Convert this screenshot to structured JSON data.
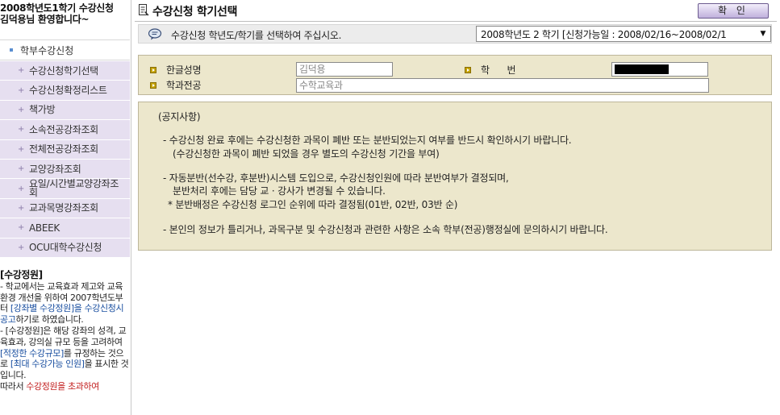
{
  "sidebar": {
    "welcome": "2008학년도1학기 수강신청\n김덕용님 환영합니다~",
    "menu_head": "학부수강신청",
    "items": [
      {
        "label": "수강신청학기선택"
      },
      {
        "label": "수강신청확정리스트"
      },
      {
        "label": "책가방"
      },
      {
        "label": "소속전공강좌조회"
      },
      {
        "label": "전체전공강좌조회"
      },
      {
        "label": "교양강좌조회"
      },
      {
        "label": "요일/시간별교양강좌조회"
      },
      {
        "label": "교과목명강좌조회"
      },
      {
        "label": "ABEEK"
      },
      {
        "label": "OCU대학수강신청"
      }
    ],
    "notice": {
      "title": "[수강정원]",
      "p1_a": "- 학교에서는 교육효과 제고와 교육환경 개선을 위하여 2007학년도부터 ",
      "p1_hl": "[강좌별 수강정원]을 수강신청시 공고",
      "p1_b": "하기로 하였습니다.",
      "p2_a": "- [수강정원]은 해당 강좌의 성격, 교육효과, 강의실 규모 등을 고려하여 ",
      "p2_hl1": "[적정한 수강규모]",
      "p2_b": "를 규정하는 것으로 ",
      "p2_hl2": "[최대 수강가능 인원]",
      "p2_c": "을 표시한 것입니다.",
      "p3_a": "따라서 ",
      "p3_red": "수강정원을 초과하여"
    }
  },
  "header": {
    "title": "수강신청 학기선택",
    "confirm_label": "확 인",
    "instruction": "수강신청 학년도/학기를 선택하여 주십시오.",
    "term_select": "2008학년도 2 학기 [신청가능일 : 2008/02/16~2008/02/1"
  },
  "student": {
    "name_label": "한글성명",
    "name_value": "김덕용",
    "id_label": "학      번",
    "dept_label": "학과전공",
    "dept_value": "수학교육과"
  },
  "notice_lines": [
    "(공지사항)",
    "- 수강신청 완료 후에는 수강신청한 과목이 폐반 또는 분반되었는지 여부를 반드시 확인하시기 바랍니다.",
    "(수강신청한 과목이 폐반 되었을 경우 별도의 수강신청 기간을 부여)",
    "- 자동분반(선수강, 후분반)시스템 도입으로, 수강신청인원에 따라 분반여부가 결정되며,",
    "분반처리 후에는 담당 교 · 강사가 변경될 수 있습니다.",
    "* 분반배정은 수강신청 로그인 순위에 따라 결정됨(01반, 02반, 03반 순)",
    "- 본인의 정보가 틀리거나, 과목구분 및 수강신청과 관련한 사항은 소속 학부(전공)행정실에 문의하시기 바랍니다."
  ],
  "colors": {
    "menu_bg": "#e6dff0",
    "panel_bg": "#ece7cc",
    "link_blue": "#1a4fa0",
    "alert_red": "#c21d1d"
  }
}
